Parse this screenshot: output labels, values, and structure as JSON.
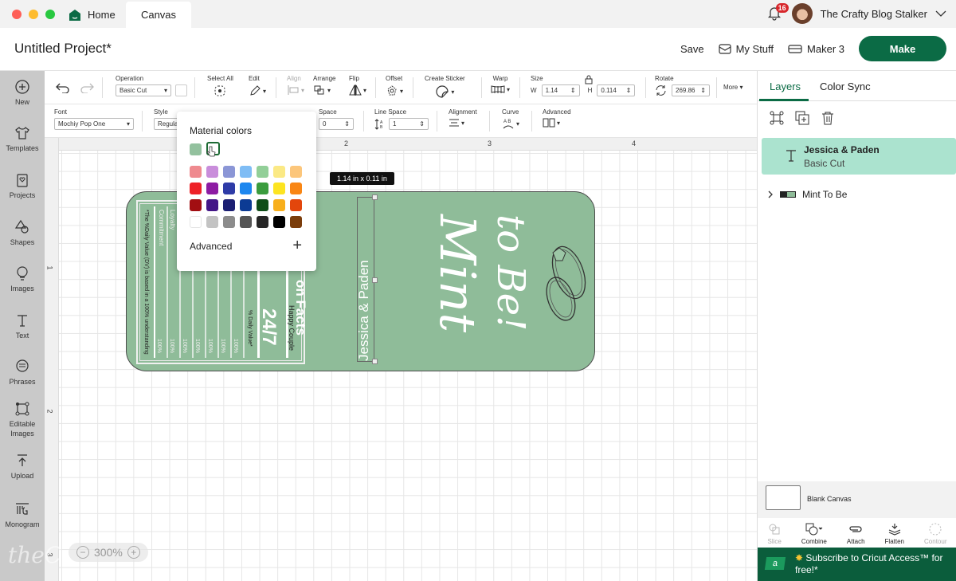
{
  "window": {
    "tabs": [
      {
        "label": "Home",
        "icon": "home-icon"
      },
      {
        "label": "Canvas"
      }
    ],
    "notifications_count": "16",
    "user_name": "The Crafty Blog Stalker",
    "traffic_lights": [
      "#fe5f57",
      "#febc2e",
      "#28c840"
    ]
  },
  "header": {
    "project_title": "Untitled Project*",
    "save_label": "Save",
    "my_stuff_label": "My Stuff",
    "machine_label": "Maker 3",
    "make_label": "Make"
  },
  "left_nav": [
    {
      "label": "New",
      "icon": "plus-circle-icon"
    },
    {
      "label": "Templates",
      "icon": "shirt-icon"
    },
    {
      "label": "Projects",
      "icon": "projects-icon"
    },
    {
      "label": "Shapes",
      "icon": "shapes-icon"
    },
    {
      "label": "Images",
      "icon": "lightbulb-icon"
    },
    {
      "label": "Text",
      "icon": "text-icon"
    },
    {
      "label": "Phrases",
      "icon": "speech-bubble-icon"
    },
    {
      "label": "Editable Images",
      "icon": "editable-images-icon"
    },
    {
      "label": "Upload",
      "icon": "upload-icon"
    },
    {
      "label": "Monogram",
      "icon": "monogram-icon"
    }
  ],
  "toolbar": {
    "operation_label": "Operation",
    "operation_value": "Basic Cut",
    "select_all_label": "Select All",
    "edit_label": "Edit",
    "align_label": "Align",
    "arrange_label": "Arrange",
    "flip_label": "Flip",
    "offset_label": "Offset",
    "create_sticker_label": "Create Sticker",
    "warp_label": "Warp",
    "size_label": "Size",
    "w_label": "W",
    "w_value": "1.14",
    "h_label": "H",
    "h_value": "0.114",
    "rotate_label": "Rotate",
    "rotate_value": "269.86",
    "more_label": "More"
  },
  "text_toolbar": {
    "font_label": "Font",
    "font_value": "Mochiy Pop One",
    "style_label": "Style",
    "style_value": "Regular",
    "letter_space_label": "Space",
    "letter_space_value": "0",
    "line_space_label": "Line Space",
    "line_space_value": "1",
    "alignment_label": "Alignment",
    "curve_label": "Curve",
    "advanced_label": "Advanced"
  },
  "canvas": {
    "ruler_top": [
      "2",
      "3",
      "4"
    ],
    "ruler_left": [
      "1",
      "2",
      "3"
    ],
    "zoom_level": "300%",
    "dimension_tooltip": "1.14  in x 0.11  in",
    "design": {
      "names_text": "Jessica & Paden",
      "headline_1": "Mint",
      "headline_2": "to Be!",
      "facts_title": "on Facts",
      "facts_subtitle": "Happy Couple",
      "facts_big": "24/7",
      "facts_dv": "% Daily Value*",
      "facts_rows": [
        "Loyalty",
        "Commitment"
      ],
      "facts_percents": [
        "100%",
        "100%",
        "100%",
        "100%",
        "100%",
        "100%",
        "100%",
        "100%"
      ],
      "facts_footnote": "*The %Daily Value (DV) is based in a 100% understanding",
      "background_color": "#8fbc99"
    }
  },
  "color_popup": {
    "title": "Material colors",
    "current": [
      "#93c19e",
      "#ffffff"
    ],
    "swatches": [
      [
        "#ef8a8f",
        "#c98ddb",
        "#8b96d6",
        "#7fbdf5",
        "#92cf98",
        "#fbe985",
        "#fcc67b"
      ],
      [
        "#ee2127",
        "#8d1ca3",
        "#2e3ba7",
        "#1d87ef",
        "#3b9c3e",
        "#fde421",
        "#f98614"
      ],
      [
        "#a20e12",
        "#431687",
        "#1b1f73",
        "#0c3b94",
        "#0f4d18",
        "#f8af1c",
        "#e3460c"
      ],
      [
        "#ffffff",
        "#c3c3c3",
        "#8c8c8c",
        "#555555",
        "#262626",
        "#000000",
        "#7b3d0b"
      ]
    ],
    "advanced_label": "Advanced"
  },
  "right_panel": {
    "tabs": [
      "Layers",
      "Color Sync"
    ],
    "layers": [
      {
        "name": "Jessica & Paden",
        "operation": "Basic Cut",
        "selected": true
      },
      {
        "name": "Mint To Be",
        "selected": false
      }
    ],
    "blank_canvas_label": "Blank Canvas",
    "tools": [
      {
        "label": "Slice",
        "enabled": false
      },
      {
        "label": "Combine",
        "enabled": true
      },
      {
        "label": "Attach",
        "enabled": true
      },
      {
        "label": "Flatten",
        "enabled": true
      },
      {
        "label": "Contour",
        "enabled": false
      }
    ],
    "promo_badge": "a",
    "promo_text": "Subscribe to Cricut Access™ for free!*"
  },
  "colors": {
    "brand": "#0b6b45",
    "selected_layer": "#abe3cf"
  }
}
